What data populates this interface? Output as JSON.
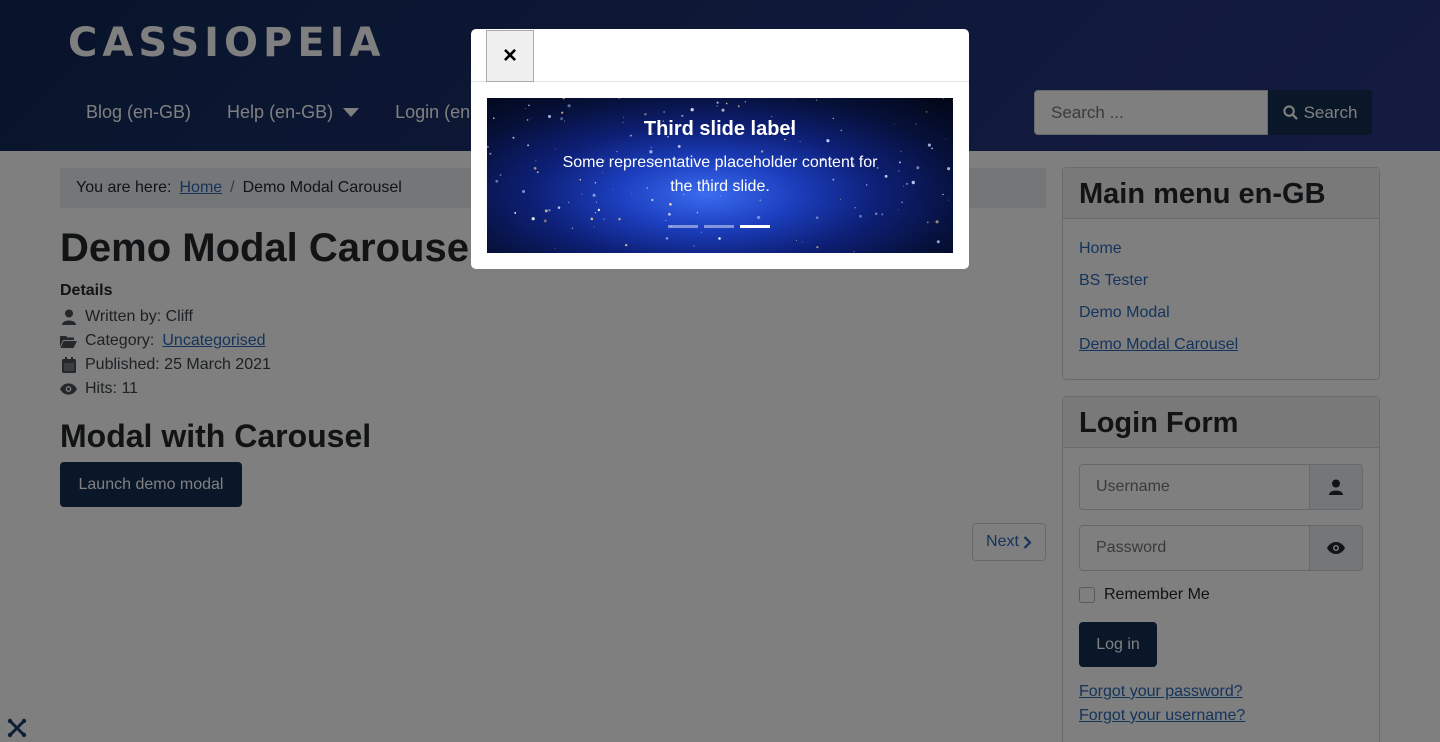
{
  "site": {
    "brand": "CASSIOPEIA"
  },
  "nav": {
    "items": [
      "Blog (en-GB)",
      "Help (en-GB)",
      "Login (en-"
    ]
  },
  "search": {
    "placeholder": "Search ...",
    "button": "Search"
  },
  "breadcrumb": {
    "prefix": "You are here:",
    "home": "Home",
    "separator": "/",
    "current": "Demo Modal Carousel"
  },
  "article": {
    "title": "Demo Modal Carousel",
    "details_label": "Details",
    "written_by": "Written by: Cliff",
    "category_label": "Category:",
    "category": "Uncategorised",
    "published": "Published: 25 March 2021",
    "hits": "Hits: 11",
    "section_title": "Modal with Carousel",
    "launch_button": "Launch demo modal",
    "next": "Next"
  },
  "main_menu": {
    "title": "Main menu en-GB",
    "items": [
      "Home",
      "BS Tester",
      "Demo Modal",
      "Demo Modal Carousel"
    ]
  },
  "login_form": {
    "title": "Login Form",
    "username_placeholder": "Username",
    "password_placeholder": "Password",
    "remember": "Remember Me",
    "submit": "Log in",
    "forgot_password": "Forgot your password?",
    "forgot_username": "Forgot your username?"
  },
  "modal": {
    "close": "×",
    "slide_title": "Third slide label",
    "slide_text": "Some representative placeholder content for the third slide.",
    "indicators": 3,
    "active_indicator": 3
  },
  "colors": {
    "header": "#1f3276",
    "primary_button": "#132f53",
    "link": "#2a69b8"
  }
}
